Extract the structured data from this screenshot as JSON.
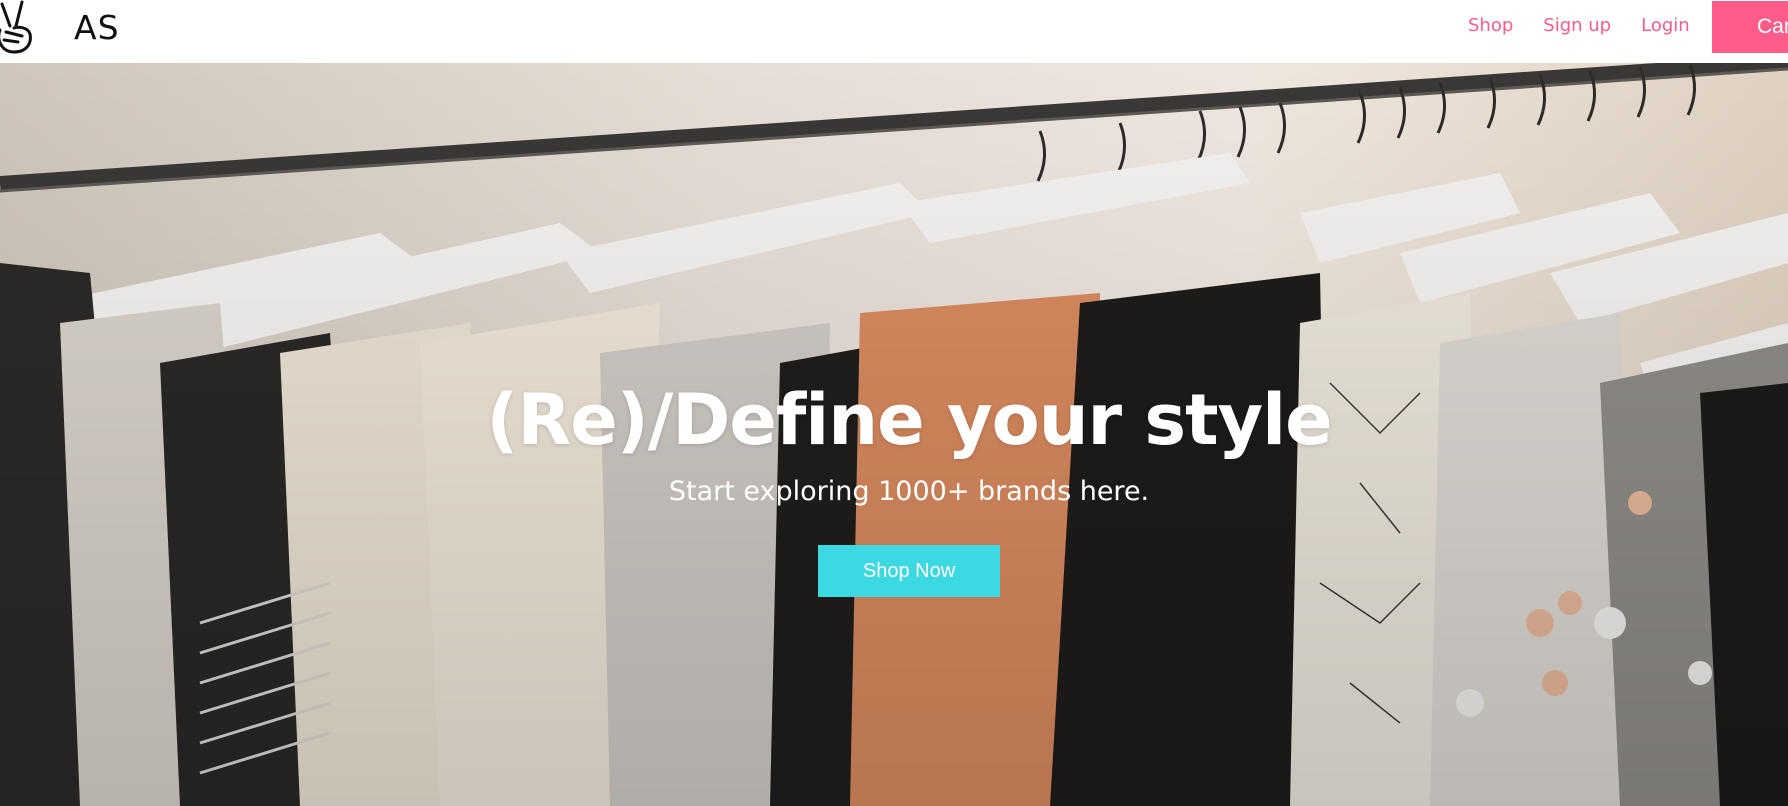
{
  "navbar": {
    "brand": "AS",
    "logo_icon": "peace-hand-icon",
    "links": [
      {
        "label": "Shop"
      },
      {
        "label": "Sign up"
      },
      {
        "label": "Login"
      }
    ],
    "cart_label": "Car"
  },
  "hero": {
    "title": "(Re)/Define your style",
    "subtitle": "Start exploring 1000+ brands here.",
    "cta_label": "Shop Now",
    "background": "clothing-rack-photo"
  },
  "colors": {
    "accent_pink": "#ff5c8a",
    "accent_cyan": "#3dd9e3",
    "text_dark": "#111111",
    "white": "#ffffff"
  }
}
